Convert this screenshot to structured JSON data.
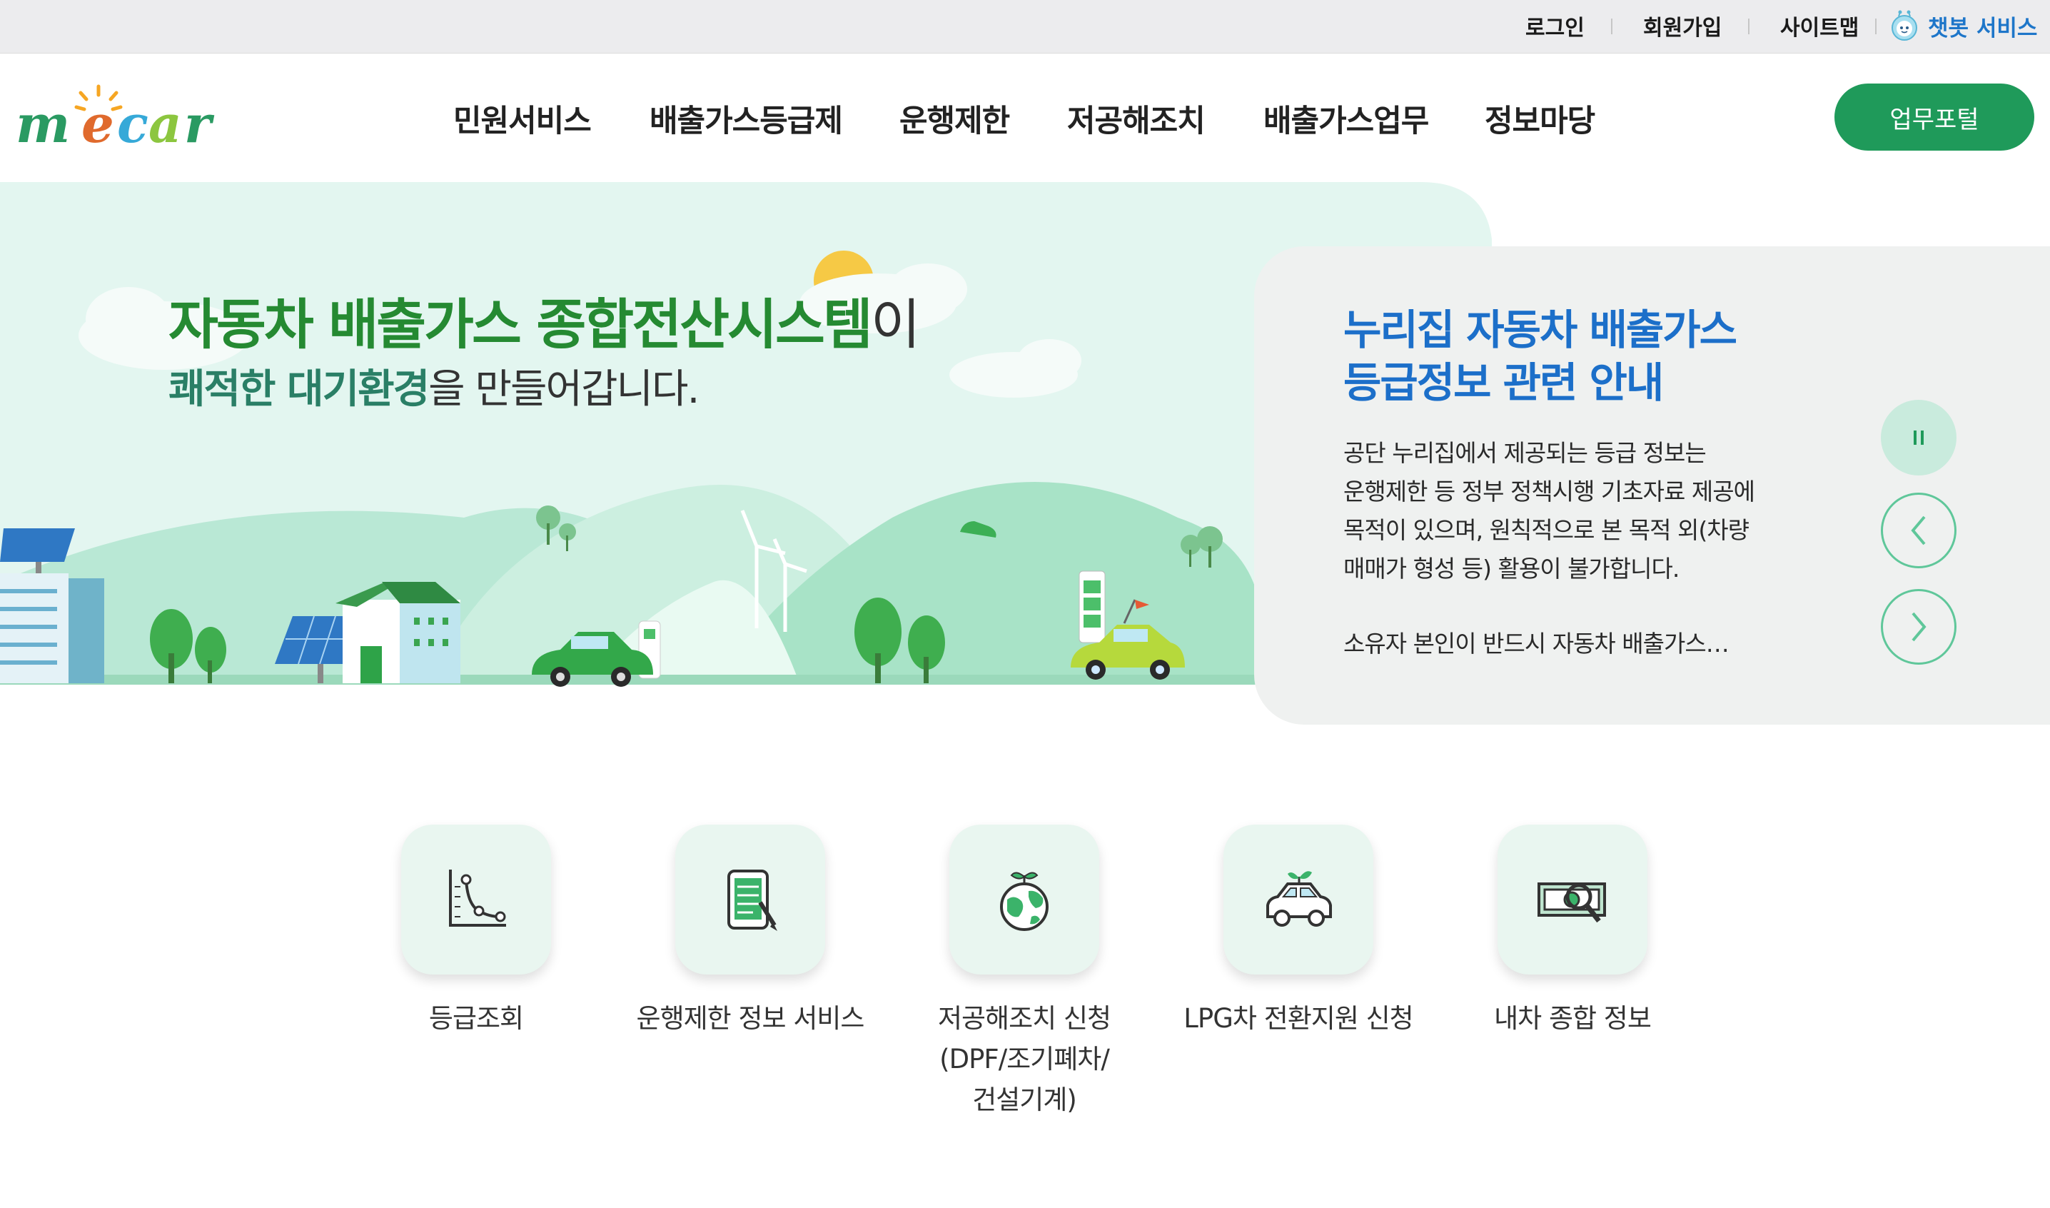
{
  "topbar": {
    "login": "로그인",
    "signup": "회원가입",
    "sitemap": "사이트맵",
    "chatbot": "챗봇 서비스"
  },
  "header": {
    "logo_text": "mecar",
    "nav": [
      "민원서비스",
      "배출가스등급제",
      "운행제한",
      "저공해조치",
      "배출가스업무",
      "정보마당"
    ],
    "portal_button": "업무포털"
  },
  "hero": {
    "title_bold": "자동차 배출가스 종합전산시스템",
    "title_tail": "이",
    "sub_highlight": "쾌적한 대기환경",
    "sub_rest": "을 만들어갑니다."
  },
  "notice": {
    "title_line1": "누리집 자동차 배출가스",
    "title_line2": "등급정보 관련 안내",
    "body_line1": "공단 누리집에서 제공되는 등급 정보는",
    "body_line2": "운행제한 등 정부 정책시행 기초자료 제공에",
    "body_line3": "목적이 있으며, 원칙적으로 본 목적 외(차량",
    "body_line4": "매매가 형성 등) 활용이 불가합니다.",
    "more": "소유자 본인이 반드시 자동차 배출가스…",
    "pause_icon": "pause-icon",
    "prev_icon": "chevron-left-icon",
    "next_icon": "chevron-right-icon"
  },
  "quick_menu": [
    {
      "label": "등급조회",
      "icon": "graph-icon"
    },
    {
      "label": "운행제한 정보 서비스",
      "icon": "tablet-pen-icon"
    },
    {
      "label_line1": "저공해조치 신청",
      "label_line2": "(DPF/조기폐차/",
      "label_line3": "건설기계)",
      "icon": "earth-sprout-icon"
    },
    {
      "label": "LPG차 전환지원 신청",
      "icon": "eco-car-icon"
    },
    {
      "label": "내차 종합 정보",
      "icon": "money-search-icon"
    }
  ],
  "colors": {
    "brand_green": "#1f9a5a",
    "hero_title_green": "#258a32",
    "notice_blue": "#1c6fc9",
    "chatbot_blue": "#1e76c9"
  }
}
